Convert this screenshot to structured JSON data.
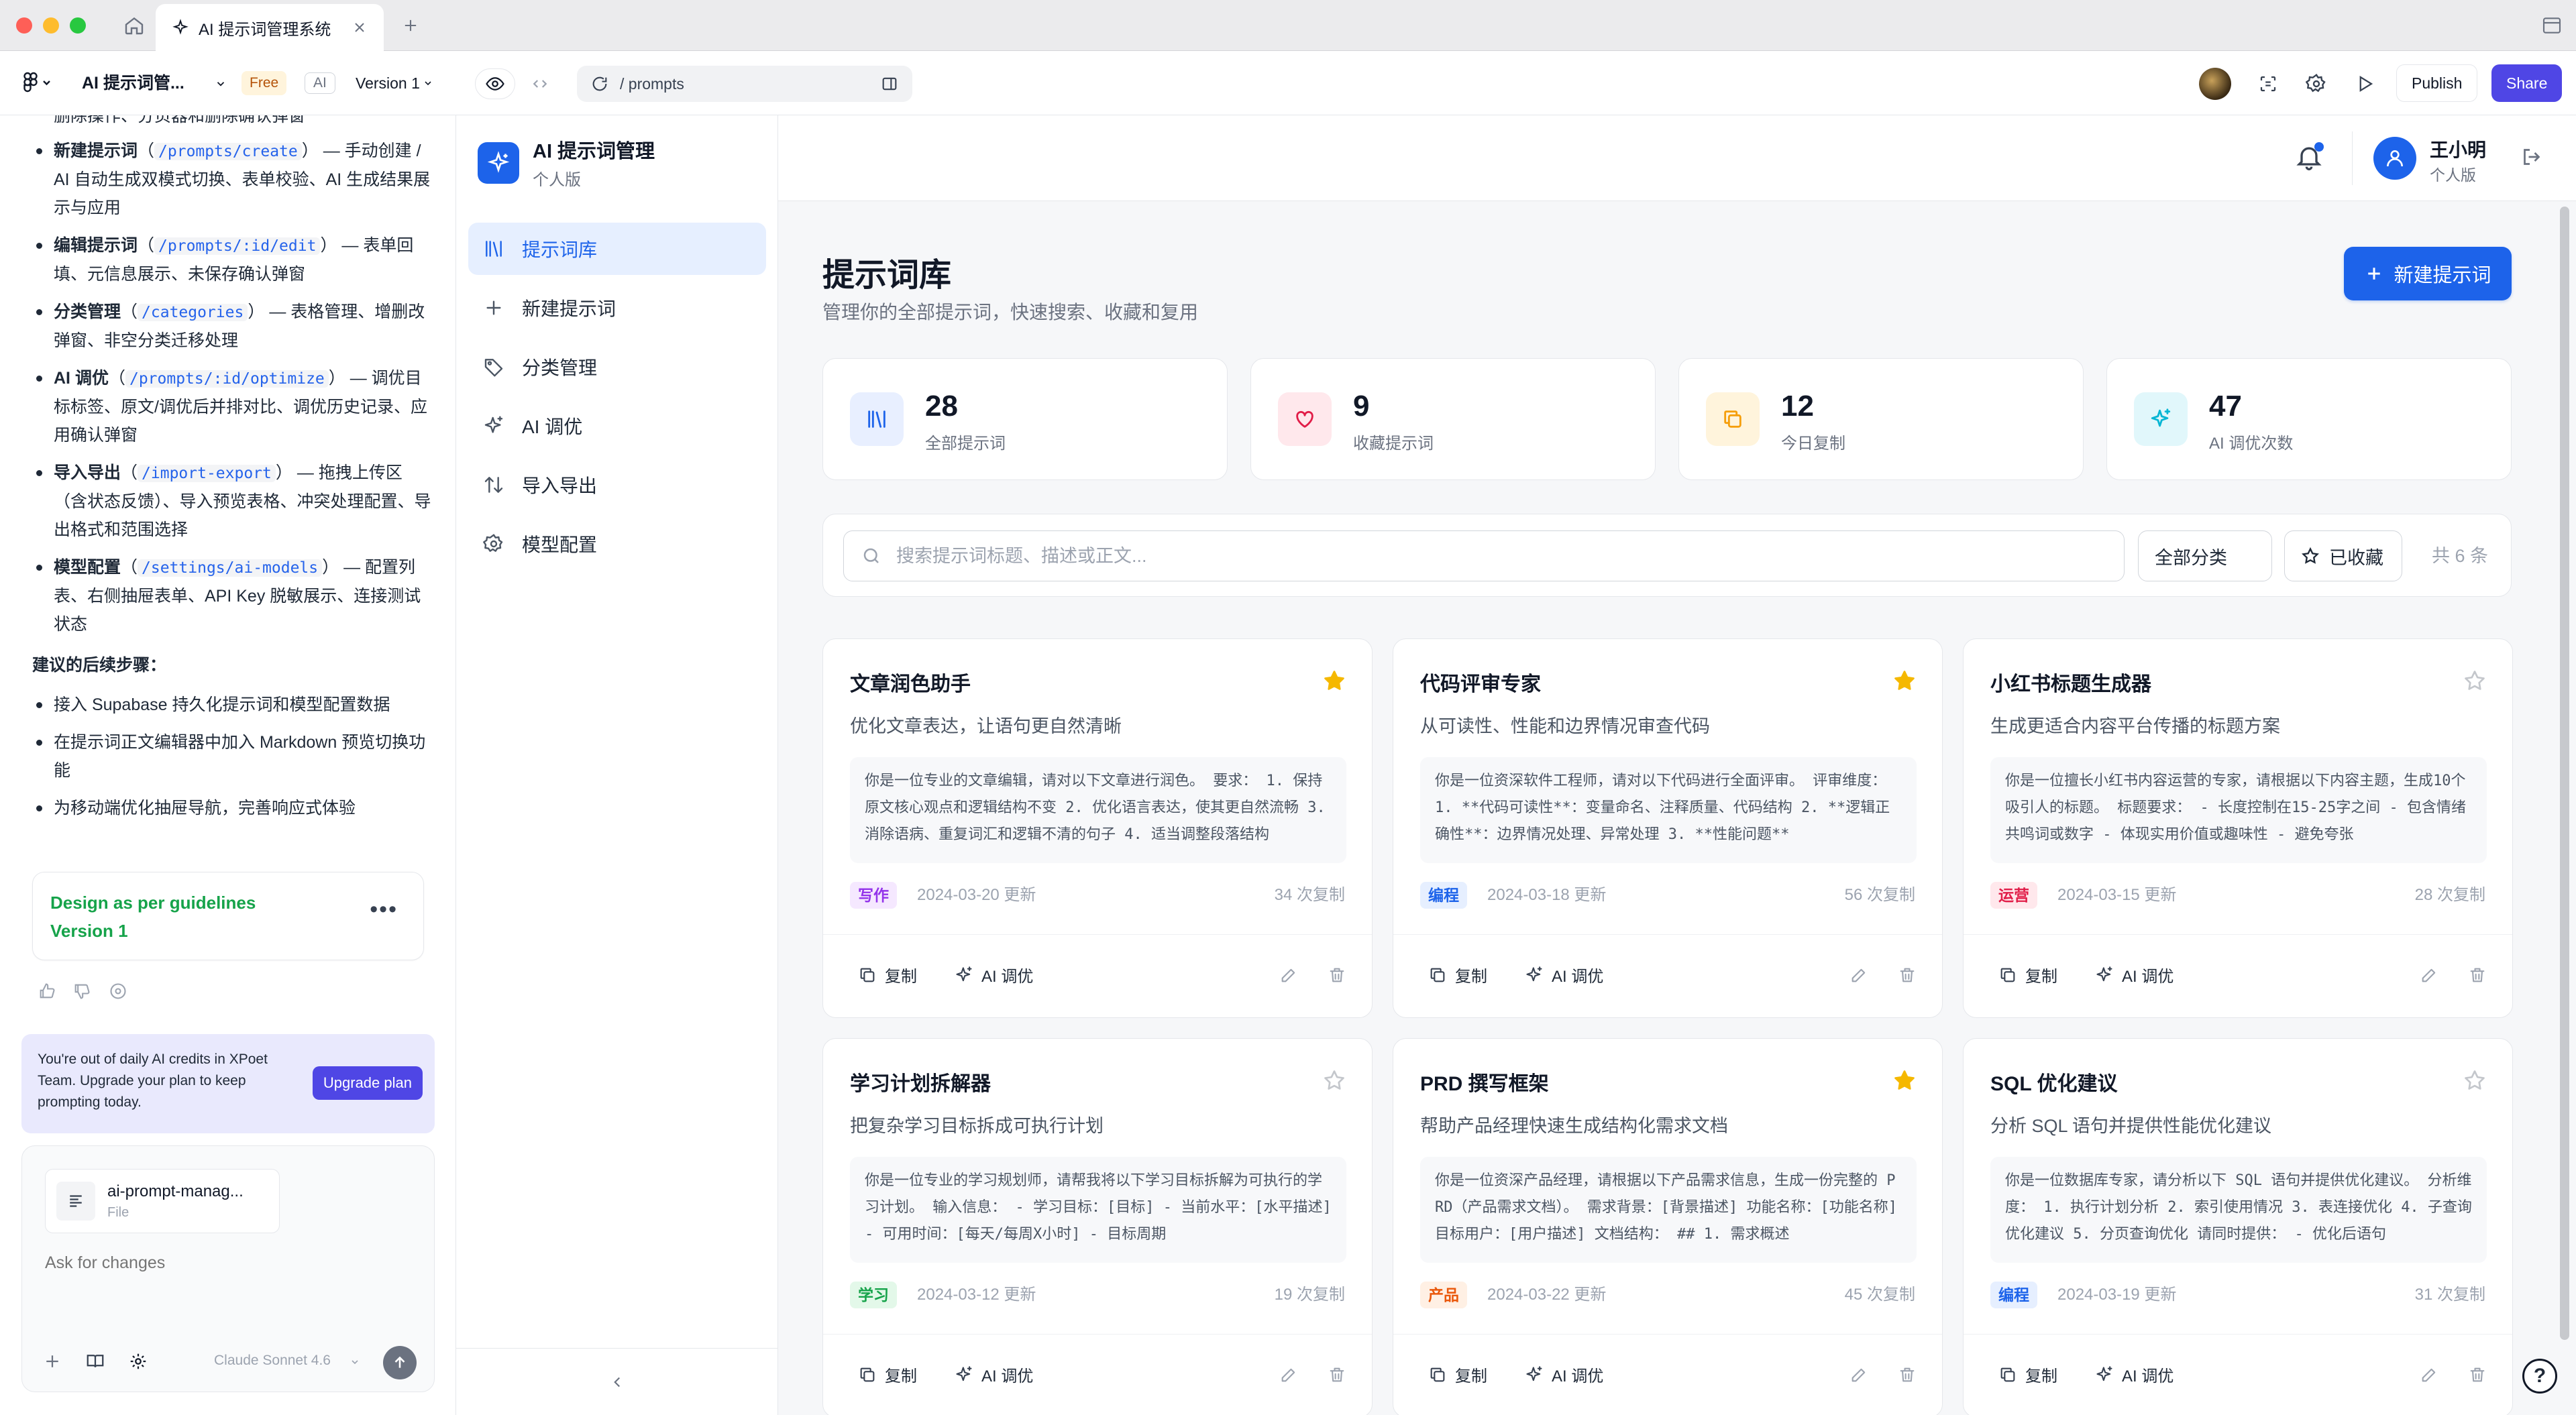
{
  "window": {
    "tab_title": "AI 提示词管理系统",
    "traffic_colors": [
      "#fe5f57",
      "#febc2e",
      "#28c840"
    ]
  },
  "toolbar": {
    "project_name": "AI 提示词管...",
    "plan_badge": "Free",
    "ai_badge": "AI",
    "version": "Version 1",
    "url_path": "/ prompts",
    "publish_label": "Publish",
    "share_label": "Share"
  },
  "chat": {
    "top_fragment": "删除操作、分页器和删除确认弹窗",
    "items": [
      {
        "name": "新建提示词",
        "open": "（",
        "route": "/prompts/create",
        "close": "）",
        "desc": "— 手动创建 / AI 自动生成双模式切换、表单校验、AI 生成结果展示与应用"
      },
      {
        "name": "编辑提示词",
        "open": "（",
        "route": "/prompts/:id/edit",
        "close": "）",
        "desc": "— 表单回填、元信息展示、未保存确认弹窗"
      },
      {
        "name": "分类管理",
        "open": "（",
        "route": "/categories",
        "close": "）",
        "desc": "— 表格管理、增删改弹窗、非空分类迁移处理"
      },
      {
        "name": "AI 调优",
        "open": "（",
        "route": "/prompts/:id/optimize",
        "close": "）",
        "desc": "— 调优目标标签、原文/调优后并排对比、调优历史记录、应用确认弹窗"
      },
      {
        "name": "导入导出",
        "open": "（",
        "route": "/import-export",
        "close": "）",
        "desc": "— 拖拽上传区（含状态反馈）、导入预览表格、冲突处理配置、导出格式和范围选择"
      },
      {
        "name": "模型配置",
        "open": "（",
        "route": "/settings/ai-models",
        "close": "）",
        "desc": "— 配置列表、右侧抽屉表单、API Key 脱敏展示、连接测试状态"
      }
    ],
    "next_steps_title": "建议的后续步骤：",
    "next_steps": [
      "接入 Supabase 持久化提示词和模型配置数据",
      "在提示词正文编辑器中加入 Markdown 预览切换功能",
      "为移动端优化抽屉导航，完善响应式体验"
    ],
    "design_card": {
      "title": "Design as per guidelines",
      "version": "Version 1"
    },
    "upgrade": {
      "text": "You're out of daily AI credits in XPoet Team. Upgrade your plan to keep prompting today.",
      "button": "Upgrade plan"
    },
    "file": {
      "name": "ai-prompt-manag...",
      "type": "File"
    },
    "placeholder": "Ask for changes",
    "model": "Claude Sonnet 4.6"
  },
  "app": {
    "brand_title": "AI 提示词管理",
    "brand_sub": "个人版",
    "nav": [
      {
        "label": "提示词库",
        "icon": "library-icon",
        "active": true
      },
      {
        "label": "新建提示词",
        "icon": "plus-icon",
        "active": false
      },
      {
        "label": "分类管理",
        "icon": "tag-icon",
        "active": false
      },
      {
        "label": "AI 调优",
        "icon": "sparkles-icon",
        "active": false
      },
      {
        "label": "导入导出",
        "icon": "arrows-updown-icon",
        "active": false
      },
      {
        "label": "模型配置",
        "icon": "settings-icon",
        "active": false
      }
    ],
    "user_name": "王小明",
    "user_plan": "个人版"
  },
  "page": {
    "title": "提示词库",
    "subtitle": "管理你的全部提示词，快速搜索、收藏和复用",
    "new_button": "新建提示词"
  },
  "stats": [
    {
      "value": "28",
      "label": "全部提示词",
      "icon": "library-icon",
      "color": "#1d63ea",
      "bg": "#e8efff"
    },
    {
      "value": "9",
      "label": "收藏提示词",
      "icon": "heart-icon",
      "color": "#e11d48",
      "bg": "#ffe8ec"
    },
    {
      "value": "12",
      "label": "今日复制",
      "icon": "copy-icon",
      "color": "#f59e0b",
      "bg": "#fff4dc"
    },
    {
      "value": "47",
      "label": "AI 调优次数",
      "icon": "sparkles-icon",
      "color": "#06b6d4",
      "bg": "#e1f7fb"
    }
  ],
  "search": {
    "placeholder": "搜索提示词标题、描述或正文...",
    "category_filter": "全部分类",
    "favorite_filter": "已收藏",
    "count": "共 6 条"
  },
  "card_labels": {
    "copy": "复制",
    "optimize": "AI 调优"
  },
  "cards": [
    {
      "title": "文章润色助手",
      "desc": "优化文章表达，让语句更自然清晰",
      "body": "你是一位专业的文章编辑，请对以下文章进行润色。 要求： 1. 保持原文核心观点和逻辑结构不变 2. 优化语言表达，使其更自然流畅 3. 消除语病、重复词汇和逻辑不清的句子 4. 适当调整段落结构",
      "tag": "写作",
      "tag_color": "#9333ea",
      "tag_bg": "#f5e8ff",
      "date": "2024-03-20 更新",
      "copies": "34 次复制",
      "starred": true
    },
    {
      "title": "代码评审专家",
      "desc": "从可读性、性能和边界情况审查代码",
      "body": "你是一位资深软件工程师，请对以下代码进行全面评审。 评审维度： 1. **代码可读性**：变量命名、注释质量、代码结构 2. **逻辑正确性**：边界情况处理、异常处理 3. **性能问题**",
      "tag": "编程",
      "tag_color": "#1d63ea",
      "tag_bg": "#e6efff",
      "date": "2024-03-18 更新",
      "copies": "56 次复制",
      "starred": true
    },
    {
      "title": "小红书标题生成器",
      "desc": "生成更适合内容平台传播的标题方案",
      "body": "你是一位擅长小红书内容运营的专家，请根据以下内容主题，生成10个吸引人的标题。 标题要求： - 长度控制在15-25字之间 - 包含情绪共鸣词或数字 - 体现实用价值或趣味性 - 避免夸张",
      "tag": "运营",
      "tag_color": "#e11d48",
      "tag_bg": "#ffe8ec",
      "date": "2024-03-15 更新",
      "copies": "28 次复制",
      "starred": false
    },
    {
      "title": "学习计划拆解器",
      "desc": "把复杂学习目标拆成可执行计划",
      "body": "你是一位专业的学习规划师，请帮我将以下学习目标拆解为可执行的学习计划。 输入信息： - 学习目标：[目标] - 当前水平：[水平描述] - 可用时间：[每天/每周X小时] - 目标周期",
      "tag": "学习",
      "tag_color": "#16a34a",
      "tag_bg": "#e3f8e9",
      "date": "2024-03-12 更新",
      "copies": "19 次复制",
      "starred": false
    },
    {
      "title": "PRD 撰写框架",
      "desc": "帮助产品经理快速生成结构化需求文档",
      "body": "你是一位资深产品经理，请根据以下产品需求信息，生成一份完整的 PRD（产品需求文档）。 需求背景：[背景描述] 功能名称：[功能名称] 目标用户：[用户描述] 文档结构： ## 1. 需求概述",
      "tag": "产品",
      "tag_color": "#ea580c",
      "tag_bg": "#fff0e4",
      "date": "2024-03-22 更新",
      "copies": "45 次复制",
      "starred": true
    },
    {
      "title": "SQL 优化建议",
      "desc": "分析 SQL 语句并提供性能优化建议",
      "body": "你是一位数据库专家，请分析以下 SQL 语句并提供优化建议。 分析维度： 1. 执行计划分析 2. 索引使用情况 3. 表连接优化 4. 子查询优化建议 5. 分页查询优化 请同时提供： - 优化后语句",
      "tag": "编程",
      "tag_color": "#1d63ea",
      "tag_bg": "#e6efff",
      "date": "2024-03-19 更新",
      "copies": "31 次复制",
      "starred": false
    }
  ],
  "colors": {
    "accent": "#1d63ea",
    "star": "#f5b800",
    "star_empty": "#c4c7cc"
  }
}
